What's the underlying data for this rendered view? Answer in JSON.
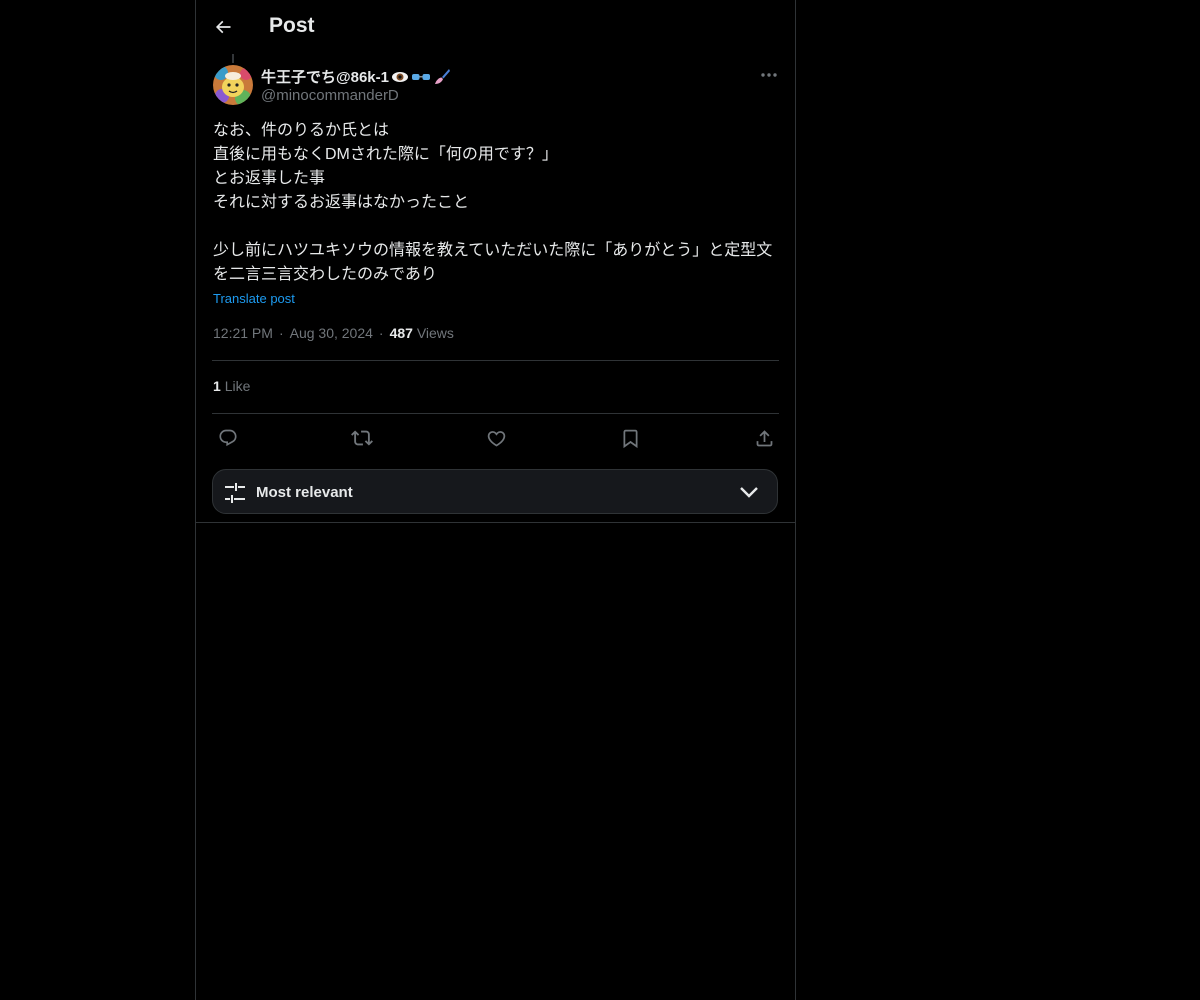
{
  "header": {
    "title": "Post"
  },
  "author": {
    "display_name": "牛王子でち@86k-1",
    "emojis": [
      "eye-emoji",
      "glasses-emoji",
      "paintbrush-emoji"
    ],
    "handle": "@minocommanderD"
  },
  "post": {
    "lines": [
      "なお、件のりるか氏とは",
      "直後に用もなくDMされた際に「何の用です？」",
      "とお返事した事",
      "それに対するお返事はなかったこと",
      "少し前にハツユキソウの情報を教えていただいた際に「ありがとう」と定型文を二言三言交わしたのみであり"
    ],
    "translate_label": "Translate post",
    "time": "12:21 PM",
    "separator": "·",
    "date": "Aug 30, 2024",
    "views_count": "487",
    "views_label": "Views"
  },
  "engagement": {
    "likes_count": "1",
    "likes_label": "Like"
  },
  "actions": [
    "reply-icon",
    "repost-icon",
    "like-icon",
    "bookmark-icon",
    "share-icon"
  ],
  "sort": {
    "label": "Most relevant"
  },
  "colors": {
    "accent": "#1d9bf0",
    "text": "#e7e9ea",
    "muted": "#71767b",
    "border": "#2f3336",
    "background": "#000000"
  }
}
